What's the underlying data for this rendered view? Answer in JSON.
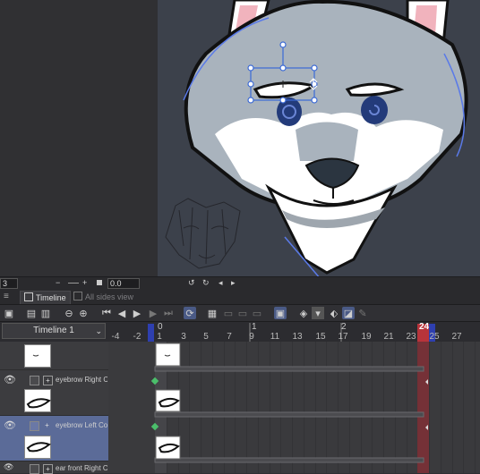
{
  "canvas_toolbar": {
    "left_value": "3",
    "minus": "−",
    "plus": "+",
    "angle_value": "0.0",
    "undo_icon": "rotate-left",
    "redo_icon": "rotate-right"
  },
  "panel_tabs": {
    "timeline": "Timeline",
    "all_sides": "All sides view"
  },
  "timeline": {
    "name": "Timeline 1",
    "frame_numbers": [
      "-4",
      "-2",
      "1",
      "3",
      "5",
      "7",
      "9",
      "11",
      "13",
      "15",
      "17",
      "19",
      "21",
      "23",
      "25",
      "27"
    ],
    "second_markers": [
      "0",
      "1",
      "2"
    ],
    "end_frame": "24",
    "layers": [
      {
        "name": "eyebrow Right Co",
        "selected": false
      },
      {
        "name": "eyebrow Left Copy",
        "selected": true
      },
      {
        "name": "ear front Right Co",
        "selected": false
      }
    ]
  },
  "colors": {
    "selection": "#5b6b98",
    "end_marker": "#b8343b",
    "start_marker": "#2e3fb0",
    "keyframe": "#4bbf6b"
  }
}
